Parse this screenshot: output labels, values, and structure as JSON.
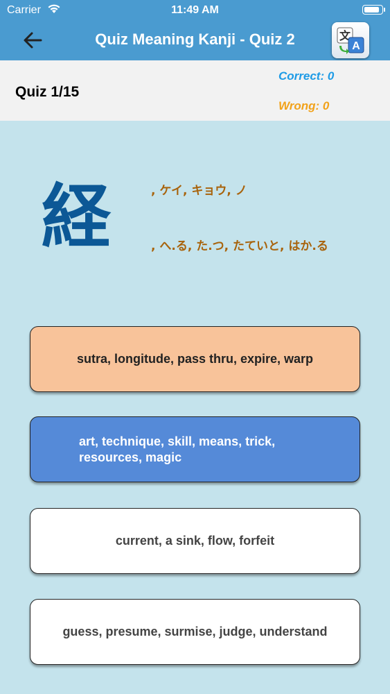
{
  "status_bar": {
    "carrier": "Carrier",
    "time": "11:49 AM",
    "battery_level": 0.9
  },
  "nav": {
    "title": "Quiz Meaning Kanji - Quiz 2",
    "back_icon": "arrow-left-icon",
    "translate_icon": "translate-icon"
  },
  "score": {
    "progress": "Quiz 1/15",
    "correct": "Correct: 0",
    "wrong": "Wrong: 0"
  },
  "question": {
    "kanji": "経",
    "reading_on": ", ケイ, キョウ, ノ",
    "reading_kun": ", へ.る, た.つ, たていと, はか.る"
  },
  "answers": [
    {
      "text": "sutra, longitude, pass thru, expire, warp",
      "color": "#f8c39a"
    },
    {
      "text": "art, technique, skill, means, trick, resources, magic",
      "color": "#558ad8"
    },
    {
      "text": "current, a sink, flow, forfeit",
      "color": "#ffffff"
    },
    {
      "text": "guess, presume, surmise, judge, understand",
      "color": "#ffffff"
    }
  ],
  "colors": {
    "nav_bg": "#4a9bd0",
    "page_bg": "#c4e3ec",
    "kanji": "#0c5896",
    "reading": "#a8630c",
    "correct": "#1e9be6",
    "wrong": "#f2a21a"
  }
}
